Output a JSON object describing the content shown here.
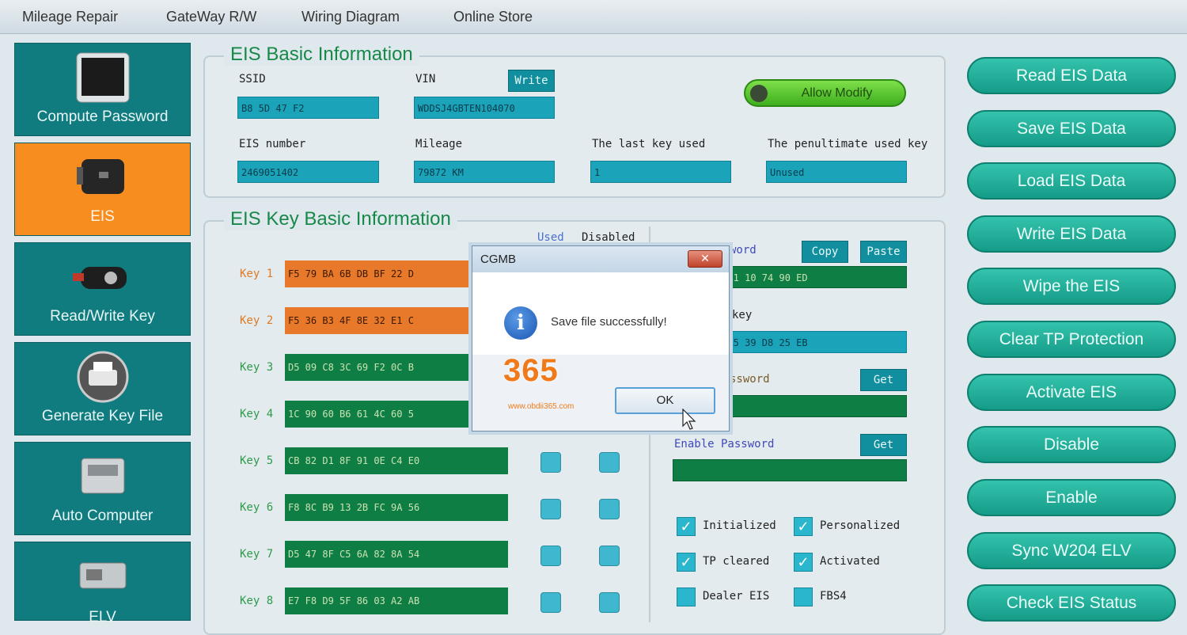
{
  "menu": [
    "Mileage Repair",
    "GateWay R/W",
    "Wiring Diagram",
    "Online Store"
  ],
  "sidebar": [
    {
      "label": "Compute Password",
      "icon": "monitor-icon",
      "active": false
    },
    {
      "label": "EIS",
      "icon": "eis-module-icon",
      "active": true
    },
    {
      "label": "Read/Write Key",
      "icon": "car-key-icon",
      "active": false
    },
    {
      "label": "Generate Key File",
      "icon": "printer-icon",
      "active": false
    },
    {
      "label": "Auto Computer",
      "icon": "ecu-icon",
      "active": false
    },
    {
      "label": "ELV",
      "icon": "elv-module-icon",
      "active": false
    }
  ],
  "basic": {
    "title": "EIS Basic Information",
    "ssid_label": "SSID",
    "ssid_value": "B8 5D 47 F2",
    "vin_label": "VIN",
    "vin_value": "WDDSJ4GBTEN104070",
    "write_label": "Write",
    "allow_modify_label": "Allow Modify",
    "eis_number_label": "EIS number",
    "eis_number_value": "2469051402",
    "mileage_label": "Mileage",
    "mileage_value": "79872 KM",
    "last_key_label": "The last key used",
    "last_key_value": "1",
    "penultimate_label": "The penultimate used key",
    "penultimate_value": "Unused"
  },
  "keys": {
    "title": "EIS Key Basic Information",
    "used_header": "Used",
    "disabled_header": "Disabled",
    "rows": [
      {
        "label": "Key 1",
        "value": "F5 79 BA 6B DB BF 22 D",
        "state": "orange"
      },
      {
        "label": "Key 2",
        "value": "F5 36 B3 4F 8E 32 E1 C",
        "state": "orange"
      },
      {
        "label": "Key 3",
        "value": "D5 09 C8 3C 69 F2 0C B",
        "state": "green"
      },
      {
        "label": "Key 4",
        "value": "1C 90 60 B6 61 4C 60 5",
        "state": "green"
      },
      {
        "label": "Key 5",
        "value": "CB 82 D1 8F 91 0E C4 E0",
        "state": "green"
      },
      {
        "label": "Key 6",
        "value": "F8 8C B9 13 2B FC 9A 56",
        "state": "green"
      },
      {
        "label": "Key 7",
        "value": "D5 47 8F C5 6A 82 8A 54",
        "state": "green"
      },
      {
        "label": "Key 8",
        "value": "E7 F8 D9 5F 86 03 A2 AB",
        "state": "green"
      }
    ]
  },
  "right_panel": {
    "password_label": "word",
    "copy_label": "Copy",
    "paste_label": "Paste",
    "password_value": "F B1 10 74 90 ED",
    "key_label": "key",
    "key_value": "C B5 39 D8 25 EB",
    "get_password_label": "ssword",
    "get1_label": "Get",
    "enable_password_label": "Enable Password",
    "get2_label": "Get"
  },
  "status": [
    {
      "label": "Initialized",
      "checked": true
    },
    {
      "label": "Personalized",
      "checked": true
    },
    {
      "label": "TP cleared",
      "checked": true
    },
    {
      "label": "Activated",
      "checked": true
    },
    {
      "label": "Dealer EIS",
      "checked": false
    },
    {
      "label": "FBS4",
      "checked": false
    }
  ],
  "actions": [
    "Read  EIS Data",
    "Save EIS Data",
    "Load EIS Data",
    "Write EIS Data",
    "Wipe the EIS",
    "Clear TP Protection",
    "Activate EIS",
    "Disable",
    "Enable",
    "Sync W204 ELV",
    "Check EIS Status"
  ],
  "dialog": {
    "title": "CGMB",
    "message": "Save file successfully!",
    "ok_label": "OK",
    "close_icon": "close-icon",
    "info_icon": "info-icon"
  },
  "watermark": {
    "logo": "365",
    "url": "www.obdii365.com"
  }
}
